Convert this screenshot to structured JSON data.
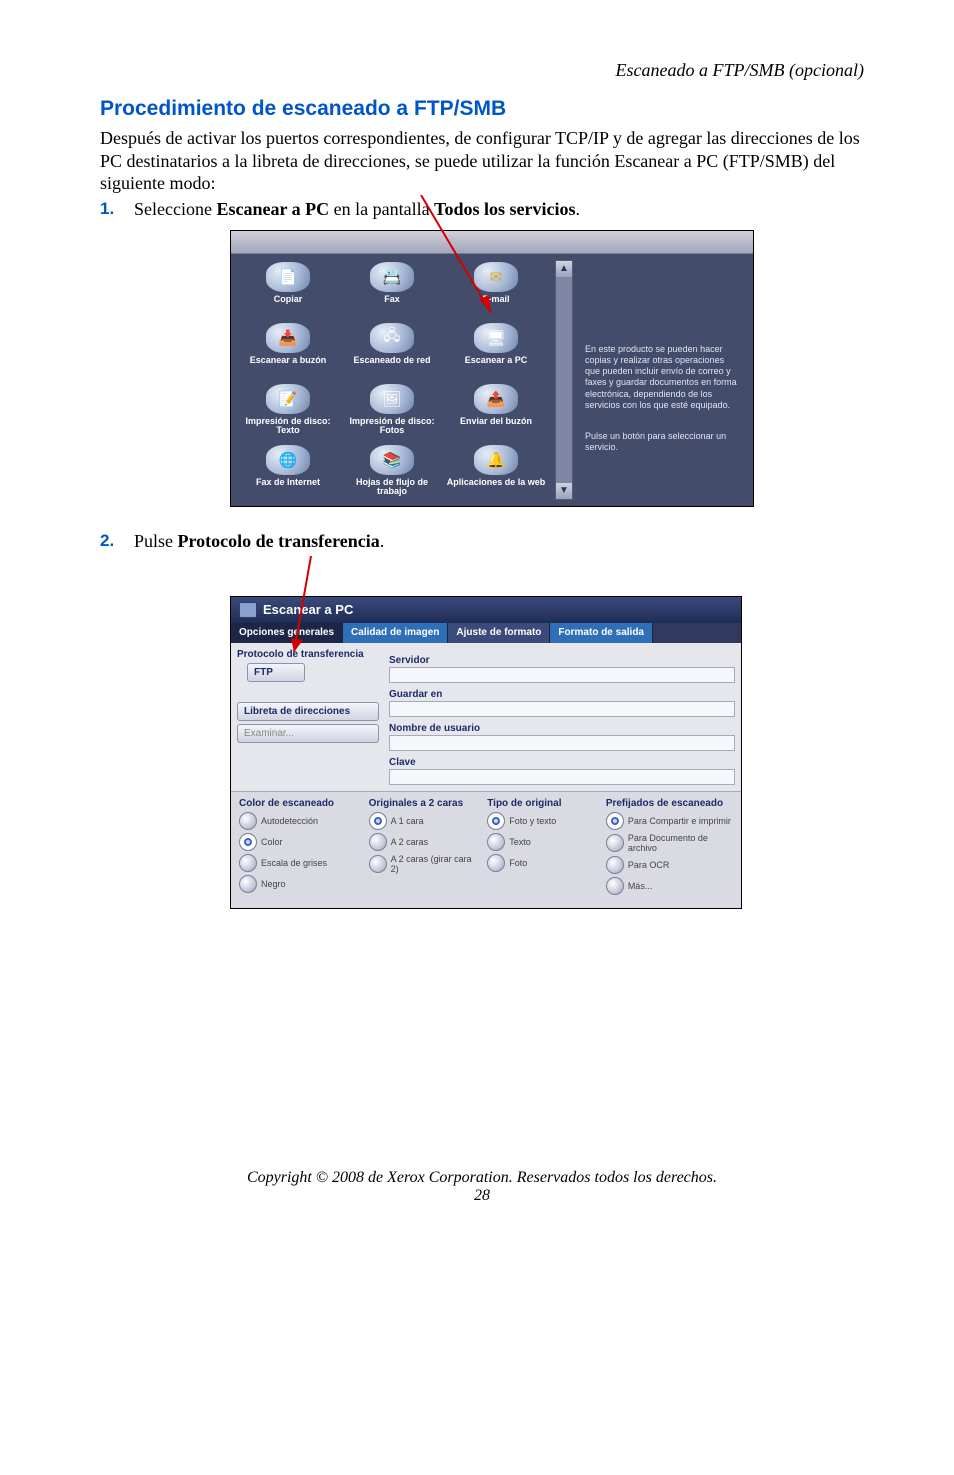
{
  "running_head": "Escaneado a FTP/SMB (opcional)",
  "heading": "Procedimiento de escaneado a FTP/SMB",
  "intro": "Después de activar los puertos correspondientes, de configurar TCP/IP y de agregar las direcciones de los PC destinatarios a la libreta de direcciones, se puede utilizar la función Escanear a PC (FTP/SMB) del siguiente modo:",
  "steps": {
    "s1": {
      "num": "1.",
      "pre": "Seleccione ",
      "b1": "Escanear a PC",
      "mid": " en la pantalla ",
      "b2": "Todos los servicios",
      "post": "."
    },
    "s2": {
      "num": "2.",
      "pre": "Pulse ",
      "b1": "Protocolo de transferencia",
      "post": "."
    }
  },
  "fig1": {
    "cells": [
      {
        "label": "Copiar"
      },
      {
        "label": "Fax"
      },
      {
        "label": "E-mail"
      },
      {
        "label": "Escanear a buzón"
      },
      {
        "label": "Escaneado de red"
      },
      {
        "label": "Escanear a PC"
      },
      {
        "label": "Impresión de disco: Texto"
      },
      {
        "label": "Impresión de disco: Fotos"
      },
      {
        "label": "Enviar del buzón"
      },
      {
        "label": "Fax de Internet"
      },
      {
        "label": "Hojas de flujo de trabajo"
      },
      {
        "label": "Aplicaciones de la web"
      }
    ],
    "info1": "En este producto se pueden hacer copias y realizar otras operaciones que pueden incluir envío de correo y faxes y guardar documentos en forma electrónica, dependiendo de los servicios con los que esté equipado.",
    "info2": "Pulse un botón para seleccionar un servicio."
  },
  "fig2": {
    "title": "Escanear a PC",
    "tabs": [
      "Opciones generales",
      "Calidad de imagen",
      "Ajuste de formato",
      "Formato de salida"
    ],
    "left": {
      "proto_label": "Protocolo de transferencia",
      "ftp": "FTP",
      "libreta": "Libreta de direcciones",
      "examinar": "Examinar..."
    },
    "fields": [
      "Servidor",
      "Guardar en",
      "Nombre de usuario",
      "Clave"
    ],
    "bottom_headers": [
      "Color de escaneado",
      "Originales a 2 caras",
      "Tipo de original",
      "Prefijados de escaneado"
    ],
    "col0": [
      "Autodetección",
      "Color",
      "Escala de grises",
      "Negro"
    ],
    "col1": [
      "A 1 cara",
      "A 2 caras",
      "A 2 caras (girar cara 2)"
    ],
    "col2": [
      "Foto y texto",
      "Texto",
      "Foto"
    ],
    "col3": [
      "Para Compartir e imprimir",
      "Para Documento de archivo",
      "Para OCR",
      "Más..."
    ]
  },
  "footer": "Copyright © 2008 de Xerox Corporation. Reservados todos los derechos.",
  "page_number": "28"
}
